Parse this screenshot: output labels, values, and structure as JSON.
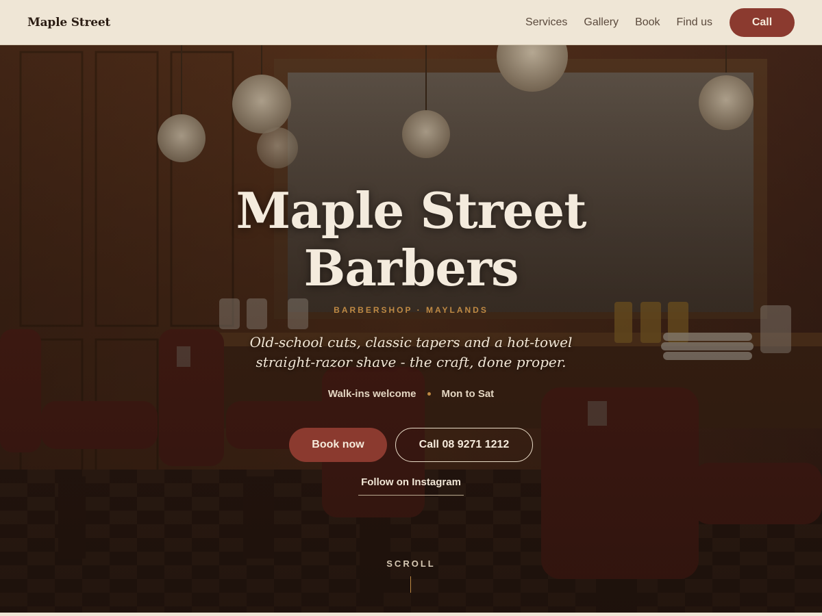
{
  "nav": {
    "brand": "Maple Street",
    "links": [
      "Services",
      "Gallery",
      "Book",
      "Find us"
    ],
    "call_label": "Call"
  },
  "hero": {
    "title_line1": "Maple Street",
    "title_line2": "Barbers",
    "eyebrow": "BARBERSHOP · MAYLANDS",
    "tagline": "Old-school cuts, classic tapers and a hot-towel straight-razor shave - the craft, done proper.",
    "meta": [
      "Walk-ins welcome",
      "Mon to Sat"
    ],
    "book_label": "Book now",
    "call_number_label": "Call 08 9271 1212",
    "instagram_label": "Follow on Instagram",
    "scroll_label": "SCROLL"
  },
  "colors": {
    "accent": "#8b3a2f",
    "gold": "#c08a43",
    "cream": "#efe6d6",
    "dark": "#2b1d14"
  }
}
